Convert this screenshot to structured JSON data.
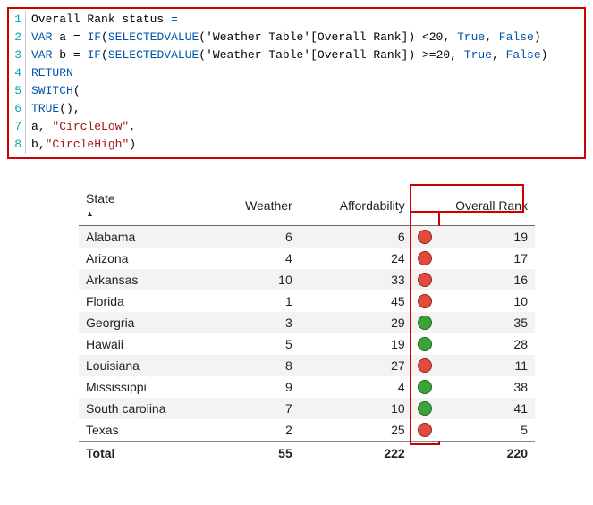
{
  "code": {
    "lines": [
      {
        "n": "1",
        "html": "<span class='ident'>Overall Rank status</span> <span class='kw'>=</span>"
      },
      {
        "n": "2",
        "html": "<span class='kw'>VAR</span> <span class='ident'>a</span> = <span class='fn'>IF</span>(<span class='fn'>SELECTEDVALUE</span>(<span class='tbl'>'Weather Table'[Overall Rank]</span>) &lt;<span class='num'>20</span>, <span class='fn'>True</span>, <span class='fn'>False</span>)"
      },
      {
        "n": "3",
        "html": "<span class='kw'>VAR</span> <span class='ident'>b</span> = <span class='fn'>IF</span>(<span class='fn'>SELECTEDVALUE</span>(<span class='tbl'>'Weather Table'[Overall Rank]</span>) &gt;=<span class='num'>20</span>, <span class='fn'>True</span>, <span class='fn'>False</span>)"
      },
      {
        "n": "4",
        "html": "<span class='kw'>RETURN</span>"
      },
      {
        "n": "5",
        "html": "<span class='fn'>SWITCH</span>("
      },
      {
        "n": "6",
        "html": "<span class='fn'>TRUE</span>(),"
      },
      {
        "n": "7",
        "html": "<span class='ident'>a</span>, <span class='str'>\"CircleLow\"</span>,"
      },
      {
        "n": "8",
        "html": "<span class='ident'>b</span>,<span class='str'>\"CircleHigh\"</span>)"
      }
    ]
  },
  "table": {
    "headers": {
      "state": "State",
      "weather": "Weather",
      "afford": "Affordability",
      "rank": "Overall Rank"
    },
    "rows": [
      {
        "state": "Alabama",
        "weather": 6,
        "afford": 6,
        "rank": 19,
        "color": "red"
      },
      {
        "state": "Arizona",
        "weather": 4,
        "afford": 24,
        "rank": 17,
        "color": "red"
      },
      {
        "state": "Arkansas",
        "weather": 10,
        "afford": 33,
        "rank": 16,
        "color": "red"
      },
      {
        "state": "Florida",
        "weather": 1,
        "afford": 45,
        "rank": 10,
        "color": "red"
      },
      {
        "state": "Georgria",
        "weather": 3,
        "afford": 29,
        "rank": 35,
        "color": "green"
      },
      {
        "state": "Hawaii",
        "weather": 5,
        "afford": 19,
        "rank": 28,
        "color": "green"
      },
      {
        "state": "Louisiana",
        "weather": 8,
        "afford": 27,
        "rank": 11,
        "color": "red"
      },
      {
        "state": "Mississippi",
        "weather": 9,
        "afford": 4,
        "rank": 38,
        "color": "green"
      },
      {
        "state": "South carolina",
        "weather": 7,
        "afford": 10,
        "rank": 41,
        "color": "green"
      },
      {
        "state": "Texas",
        "weather": 2,
        "afford": 25,
        "rank": 5,
        "color": "red"
      }
    ],
    "total": {
      "label": "Total",
      "weather": 55,
      "afford": 222,
      "rank": 220
    }
  },
  "colors": {
    "red": "#e34a3b",
    "green": "#3ba33b",
    "highlight": "#c00"
  }
}
